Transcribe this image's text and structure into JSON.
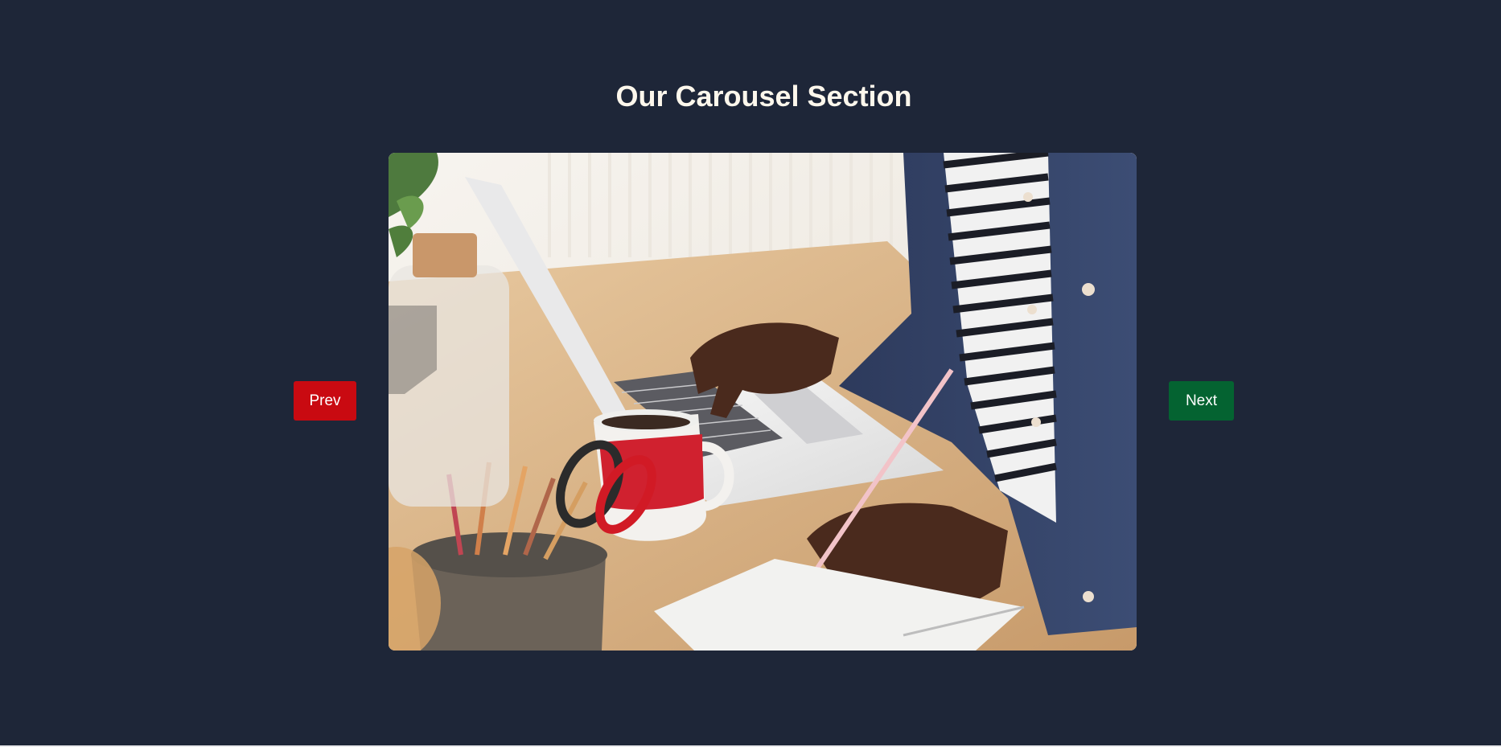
{
  "section": {
    "title": "Our Carousel Section"
  },
  "carousel": {
    "slide_description": "Person typing on a laptop at a desk with a coffee mug, notebook and pencil holder",
    "prev_label": "Prev",
    "next_label": "Next"
  },
  "colors": {
    "background": "#1e2638",
    "title_text": "#fdf7ec",
    "prev_button": "#c90a11",
    "next_button": "#046331"
  }
}
